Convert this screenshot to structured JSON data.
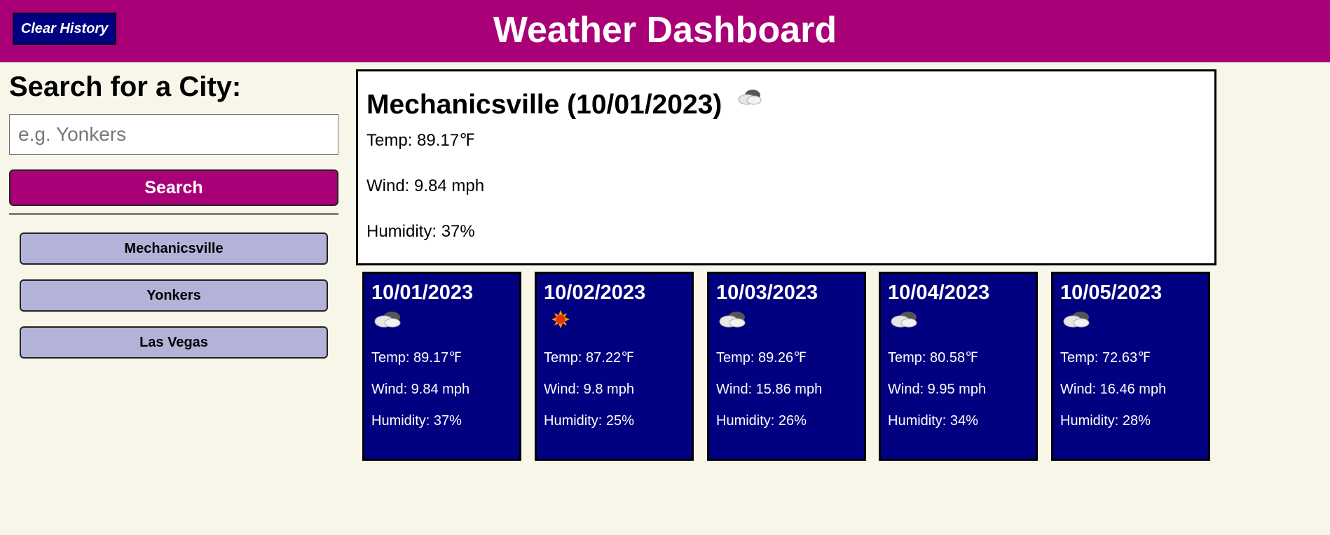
{
  "header": {
    "title": "Weather Dashboard",
    "clear_history_label": "Clear History"
  },
  "search": {
    "heading": "Search for a City:",
    "placeholder": "e.g. Yonkers",
    "value": "",
    "button_label": "Search"
  },
  "history": [
    {
      "label": "Mechanicsville"
    },
    {
      "label": "Yonkers"
    },
    {
      "label": "Las Vegas"
    }
  ],
  "current": {
    "title": "Mechanicsville (10/01/2023)",
    "icon": "cloud-icon",
    "temp_label": "Temp: 89.17",
    "temp_unit": "℉",
    "wind": "Wind: 9.84 mph",
    "humidity": "Humidity: 37%"
  },
  "forecast": [
    {
      "date": "10/01/2023",
      "icon": "cloud-icon",
      "temp_label": "Temp: 89.17",
      "temp_unit": "℉",
      "wind": "Wind: 9.84 mph",
      "humidity": "Humidity: 37%"
    },
    {
      "date": "10/02/2023",
      "icon": "sun-icon",
      "temp_label": "Temp: 87.22",
      "temp_unit": "℉",
      "wind": "Wind: 9.8 mph",
      "humidity": "Humidity: 25%"
    },
    {
      "date": "10/03/2023",
      "icon": "cloud-icon",
      "temp_label": "Temp: 89.26",
      "temp_unit": "℉",
      "wind": "Wind: 15.86 mph",
      "humidity": "Humidity: 26%"
    },
    {
      "date": "10/04/2023",
      "icon": "cloud-icon",
      "temp_label": "Temp: 80.58",
      "temp_unit": "℉",
      "wind": "Wind: 9.95 mph",
      "humidity": "Humidity: 34%"
    },
    {
      "date": "10/05/2023",
      "icon": "cloud-icon",
      "temp_label": "Temp: 72.63",
      "temp_unit": "℉",
      "wind": "Wind: 16.46 mph",
      "humidity": "Humidity: 28%"
    }
  ],
  "colors": {
    "header_bg": "#aa0077",
    "page_bg": "#f8f5e9",
    "card_bg": "#000080",
    "history_button_bg": "#b3b3d9"
  }
}
